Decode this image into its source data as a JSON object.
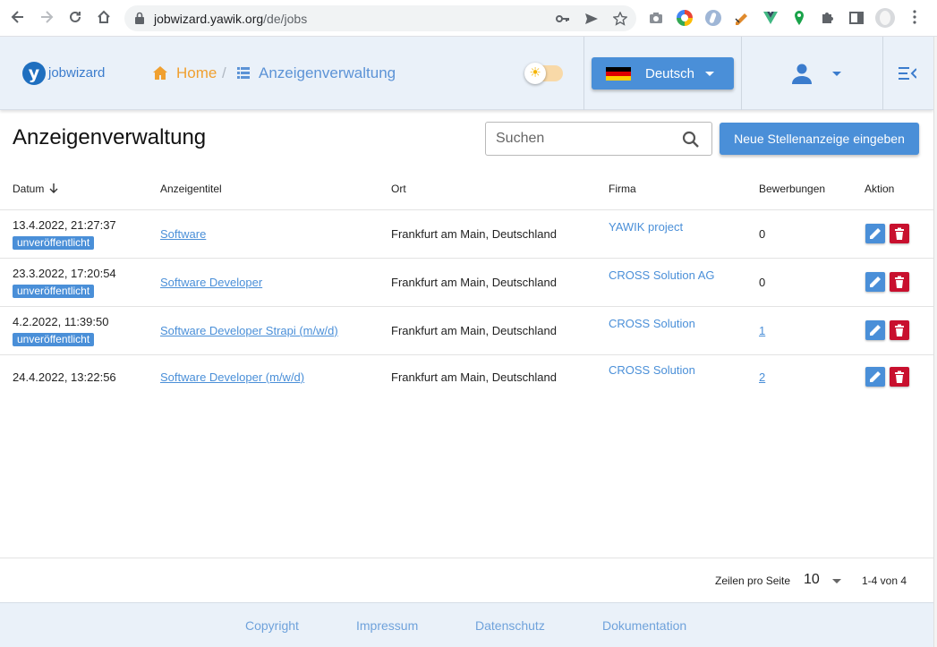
{
  "browser": {
    "url_host": "jobwizard.yawik.org",
    "url_path": "/de/jobs"
  },
  "header": {
    "logo_text": "jobwizard",
    "breadcrumb_home": "Home",
    "breadcrumb_separator": "/",
    "breadcrumb_current": "Anzeigenverwaltung",
    "language_label": "Deutsch"
  },
  "page": {
    "title": "Anzeigenverwaltung",
    "search_placeholder": "Suchen",
    "new_job_button": "Neue Stellenanzeige eingeben"
  },
  "table": {
    "headers": {
      "date": "Datum",
      "title": "Anzeigentitel",
      "location": "Ort",
      "company": "Firma",
      "applications": "Bewerbungen",
      "action": "Aktion"
    },
    "rows": [
      {
        "date": "13.4.2022, 21:27:37",
        "status": "unveröffentlicht",
        "title": "Software",
        "location": "Frankfurt am Main, Deutschland",
        "company": "YAWIK project",
        "applications": "0"
      },
      {
        "date": "23.3.2022, 17:20:54",
        "status": "unveröffentlicht",
        "title": "Software Developer",
        "location": "Frankfurt am Main, Deutschland",
        "company": "CROSS Solution AG",
        "applications": "0"
      },
      {
        "date": "4.2.2022, 11:39:50",
        "status": "unveröffentlicht",
        "title": "Software Developer Strapi (m/w/d)",
        "location": "Frankfurt am Main, Deutschland",
        "company": "CROSS Solution",
        "applications": "1"
      },
      {
        "date": "24.4.2022, 13:22:56",
        "status": "",
        "title": "Software Developer (m/w/d)",
        "location": "Frankfurt am Main, Deutschland",
        "company": "CROSS Solution",
        "applications": "2"
      }
    ]
  },
  "pagination": {
    "rows_per_page_label": "Zeilen pro Seite",
    "rows_per_page": "10",
    "range": "1-4 von 4"
  },
  "footer": {
    "links": [
      "Copyright",
      "Impressum",
      "Datenschutz",
      "Dokumentation"
    ]
  },
  "colors": {
    "primary": "#4a8fd8",
    "home": "#f0a030",
    "danger": "#c8102e",
    "header_bg": "#eaf1f9"
  }
}
